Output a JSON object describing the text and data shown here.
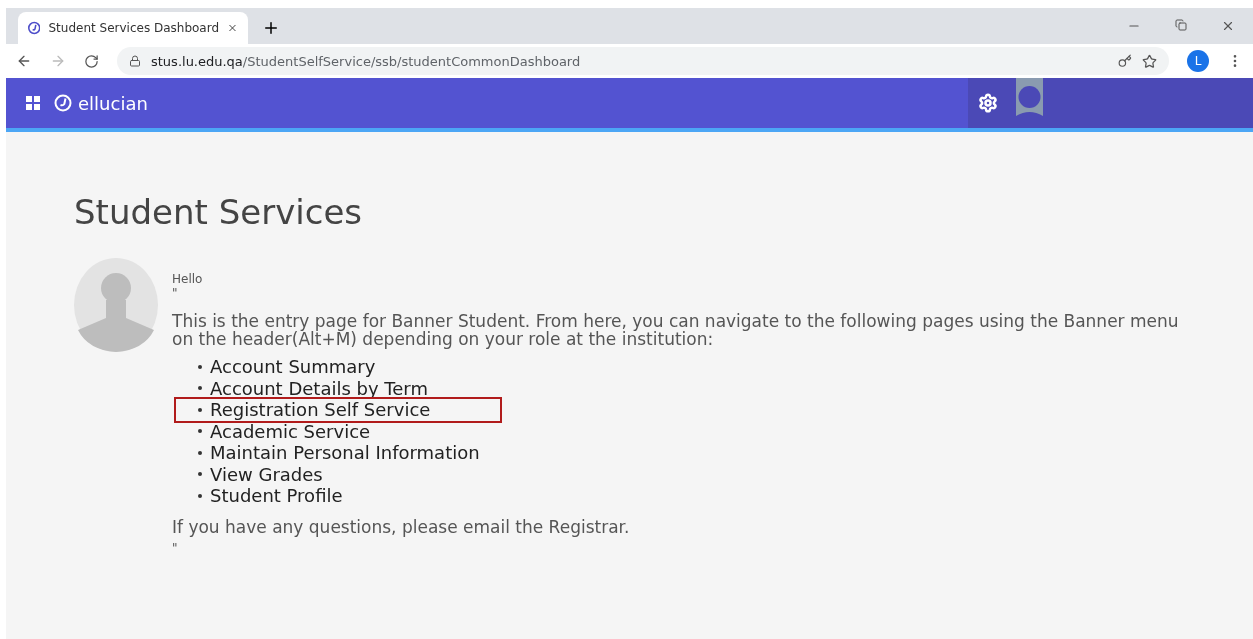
{
  "browser": {
    "tab": {
      "title": "Student Services Dashboard",
      "selected": true
    },
    "url_host": "stus.lu.edu.qa",
    "url_path": "/StudentSelfService/ssb/studentCommonDashboard",
    "profile_initial": "L"
  },
  "header": {
    "brand": "ellucian"
  },
  "page": {
    "title": "Student Services",
    "greeting": "Hello",
    "quote_mark": "\"",
    "intro": "This is the entry page for Banner Student. From here, you can navigate to the following pages using the Banner menu on the header(Alt+M) depending on your role at the institution:",
    "links": [
      {
        "label": "Account Summary",
        "highlighted": false
      },
      {
        "label": "Account Details by Term",
        "highlighted": false
      },
      {
        "label": "Registration Self Service",
        "highlighted": true
      },
      {
        "label": "Academic Service",
        "highlighted": false
      },
      {
        "label": "Maintain Personal Information",
        "highlighted": false
      },
      {
        "label": "View Grades",
        "highlighted": false
      },
      {
        "label": "Student Profile",
        "highlighted": false
      }
    ],
    "footer": "If you have any questions, please email the Registrar.",
    "closing_mark": "\""
  }
}
